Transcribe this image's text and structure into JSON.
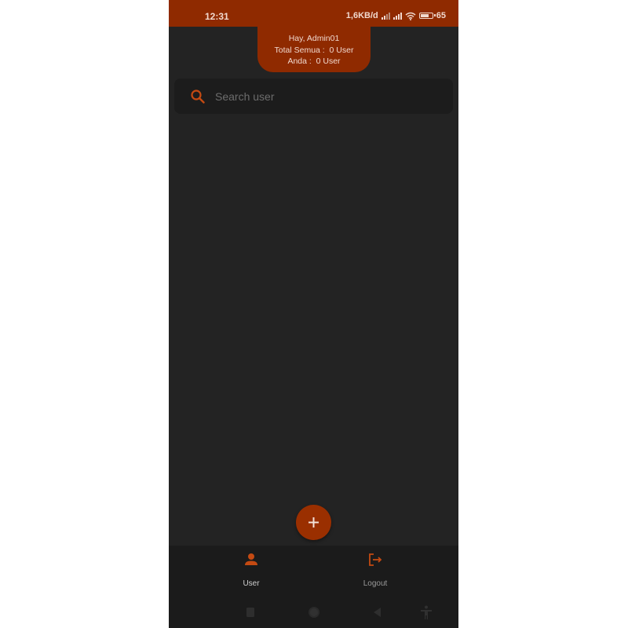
{
  "status_bar": {
    "time": "12:31",
    "data_rate": "1,6KB/d",
    "battery": "65",
    "battery_level": 0.65
  },
  "header": {
    "greeting": "Hay, Admin01",
    "total_line": "Total Semua :  0 User",
    "anda_line": "Anda :  0 User"
  },
  "search": {
    "placeholder": "Search user",
    "value": ""
  },
  "fab": {
    "icon": "plus-icon"
  },
  "bottom_nav": {
    "items": [
      {
        "label": "User",
        "icon": "person-icon",
        "active": true
      },
      {
        "label": "Logout",
        "icon": "logout-icon",
        "active": false
      }
    ]
  },
  "system_nav": {
    "icons": [
      "recents-icon",
      "home-icon",
      "back-icon",
      "accessibility-icon"
    ]
  },
  "colors": {
    "accent": "#8f2a00",
    "accent_icon": "#c44a12",
    "background": "#232323",
    "surface": "#1c1c1c",
    "text_light": "#f1d9cf"
  }
}
